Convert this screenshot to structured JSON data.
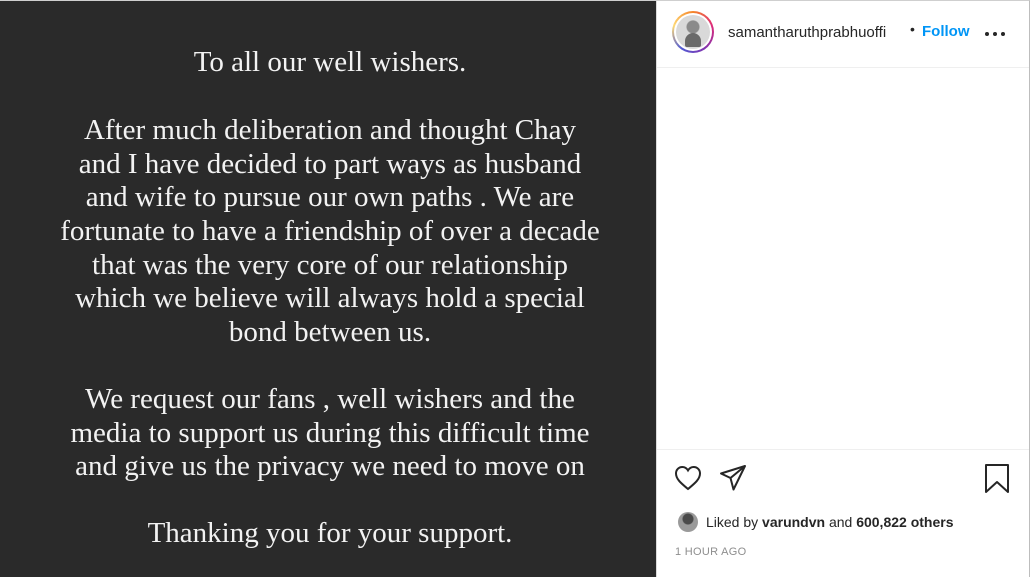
{
  "post": {
    "lines": [
      "To all our well wishers.",
      "After much deliberation and thought Chay",
      "and I have decided to part ways as husband",
      "and wife to pursue our own paths . We are",
      "fortunate to have a friendship of over a decade",
      "that was the very core of our relationship",
      "which we believe will always hold a special",
      "bond between us.",
      "We request our fans , well wishers and the",
      "media to support us during this difficult time",
      "and give us the privacy we need to move on",
      "Thanking you for your support."
    ]
  },
  "header": {
    "username": "samantharuthprabhuoffi",
    "separator": "•",
    "follow_label": "Follow"
  },
  "engagement": {
    "liked_prefix": "Liked by",
    "liked_user": "varundvn",
    "liked_and": "and",
    "liked_count": "600,822 others",
    "timestamp": "1 HOUR AGO"
  },
  "colors": {
    "image_bg": "#2a2a2a",
    "follow_blue": "#0095f6",
    "text": "#262626",
    "muted": "#8e8e8e"
  },
  "icons": [
    "heart-icon",
    "share-icon",
    "bookmark-icon",
    "more-icon"
  ]
}
